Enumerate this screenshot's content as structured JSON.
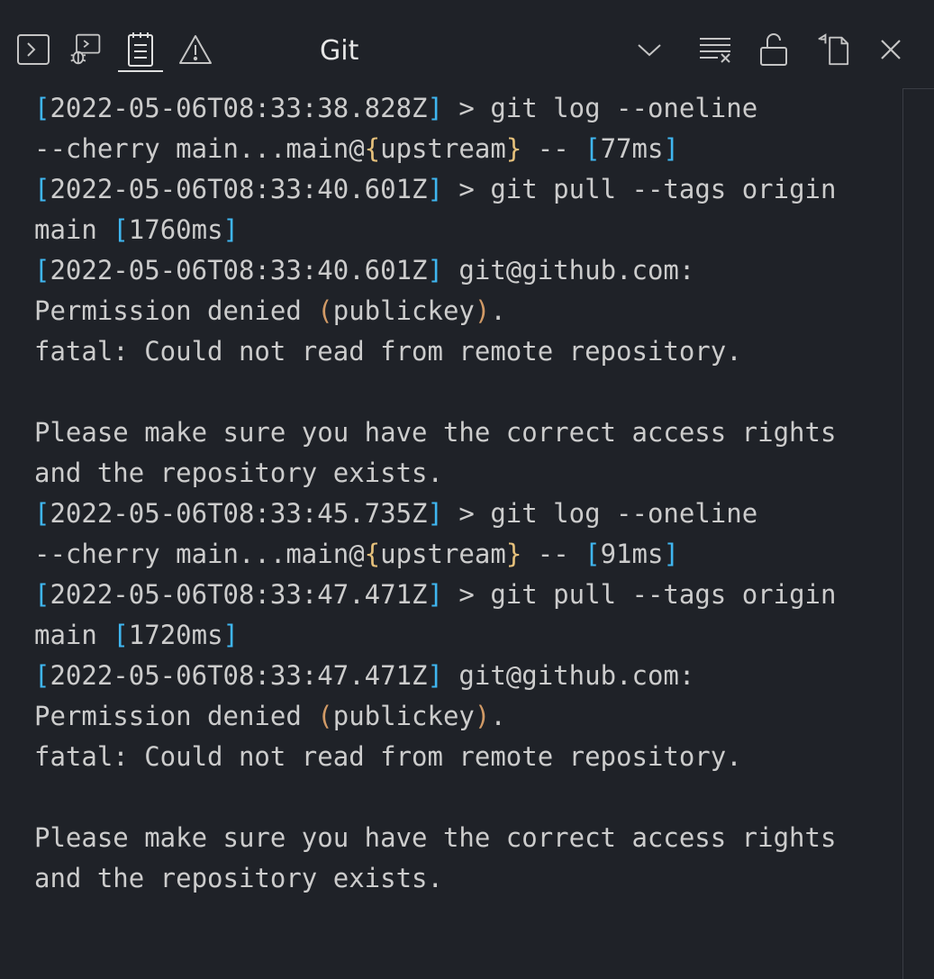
{
  "panel": {
    "title": "Git",
    "tabs": [
      {
        "icon": "terminal-icon"
      },
      {
        "icon": "debug-console-icon"
      },
      {
        "icon": "output-icon"
      },
      {
        "icon": "problems-icon"
      }
    ],
    "actions": [
      {
        "icon": "chevron-down-icon"
      },
      {
        "icon": "clear-output-icon"
      },
      {
        "icon": "unlock-icon"
      },
      {
        "icon": "open-in-editor-icon"
      },
      {
        "icon": "close-icon"
      }
    ]
  },
  "colors": {
    "background": "#1f2228",
    "text": "#cccccc",
    "bracket_square": "#3fb6f0",
    "bracket_curly": "#e5c07b",
    "bracket_round": "#d19a66"
  },
  "log": {
    "lines": [
      [
        {
          "t": "[",
          "c": "br-b"
        },
        {
          "t": "2022-05-06T08:33:38.828Z"
        },
        {
          "t": "]",
          "c": "br-b"
        },
        {
          "t": " > git log --oneline"
        }
      ],
      [
        {
          "t": "--cherry main...main@"
        },
        {
          "t": "{",
          "c": "br-y"
        },
        {
          "t": "upstream"
        },
        {
          "t": "}",
          "c": "br-y"
        },
        {
          "t": " -- "
        },
        {
          "t": "[",
          "c": "br-b"
        },
        {
          "t": "77ms"
        },
        {
          "t": "]",
          "c": "br-b"
        }
      ],
      [
        {
          "t": "[",
          "c": "br-b"
        },
        {
          "t": "2022-05-06T08:33:40.601Z"
        },
        {
          "t": "]",
          "c": "br-b"
        },
        {
          "t": " > git pull --tags origin"
        }
      ],
      [
        {
          "t": "main "
        },
        {
          "t": "[",
          "c": "br-b"
        },
        {
          "t": "1760ms"
        },
        {
          "t": "]",
          "c": "br-b"
        }
      ],
      [
        {
          "t": "[",
          "c": "br-b"
        },
        {
          "t": "2022-05-06T08:33:40.601Z"
        },
        {
          "t": "]",
          "c": "br-b"
        },
        {
          "t": " git@github.com:"
        }
      ],
      [
        {
          "t": "Permission denied "
        },
        {
          "t": "(",
          "c": "br-o"
        },
        {
          "t": "publickey"
        },
        {
          "t": ")",
          "c": "br-o"
        },
        {
          "t": "."
        }
      ],
      [
        {
          "t": "fatal: Could not read from remote repository."
        }
      ],
      [
        {
          "t": ""
        }
      ],
      [
        {
          "t": "Please make sure you have the correct access rights"
        }
      ],
      [
        {
          "t": "and the repository exists."
        }
      ],
      [
        {
          "t": "[",
          "c": "br-b"
        },
        {
          "t": "2022-05-06T08:33:45.735Z"
        },
        {
          "t": "]",
          "c": "br-b"
        },
        {
          "t": " > git log --oneline"
        }
      ],
      [
        {
          "t": "--cherry main...main@"
        },
        {
          "t": "{",
          "c": "br-y"
        },
        {
          "t": "upstream"
        },
        {
          "t": "}",
          "c": "br-y"
        },
        {
          "t": " -- "
        },
        {
          "t": "[",
          "c": "br-b"
        },
        {
          "t": "91ms"
        },
        {
          "t": "]",
          "c": "br-b"
        }
      ],
      [
        {
          "t": "[",
          "c": "br-b"
        },
        {
          "t": "2022-05-06T08:33:47.471Z"
        },
        {
          "t": "]",
          "c": "br-b"
        },
        {
          "t": " > git pull --tags origin"
        }
      ],
      [
        {
          "t": "main "
        },
        {
          "t": "[",
          "c": "br-b"
        },
        {
          "t": "1720ms"
        },
        {
          "t": "]",
          "c": "br-b"
        }
      ],
      [
        {
          "t": "[",
          "c": "br-b"
        },
        {
          "t": "2022-05-06T08:33:47.471Z"
        },
        {
          "t": "]",
          "c": "br-b"
        },
        {
          "t": " git@github.com:"
        }
      ],
      [
        {
          "t": "Permission denied "
        },
        {
          "t": "(",
          "c": "br-o"
        },
        {
          "t": "publickey"
        },
        {
          "t": ")",
          "c": "br-o"
        },
        {
          "t": "."
        }
      ],
      [
        {
          "t": "fatal: Could not read from remote repository."
        }
      ],
      [
        {
          "t": ""
        }
      ],
      [
        {
          "t": "Please make sure you have the correct access rights"
        }
      ],
      [
        {
          "t": "and the repository exists."
        }
      ]
    ]
  }
}
